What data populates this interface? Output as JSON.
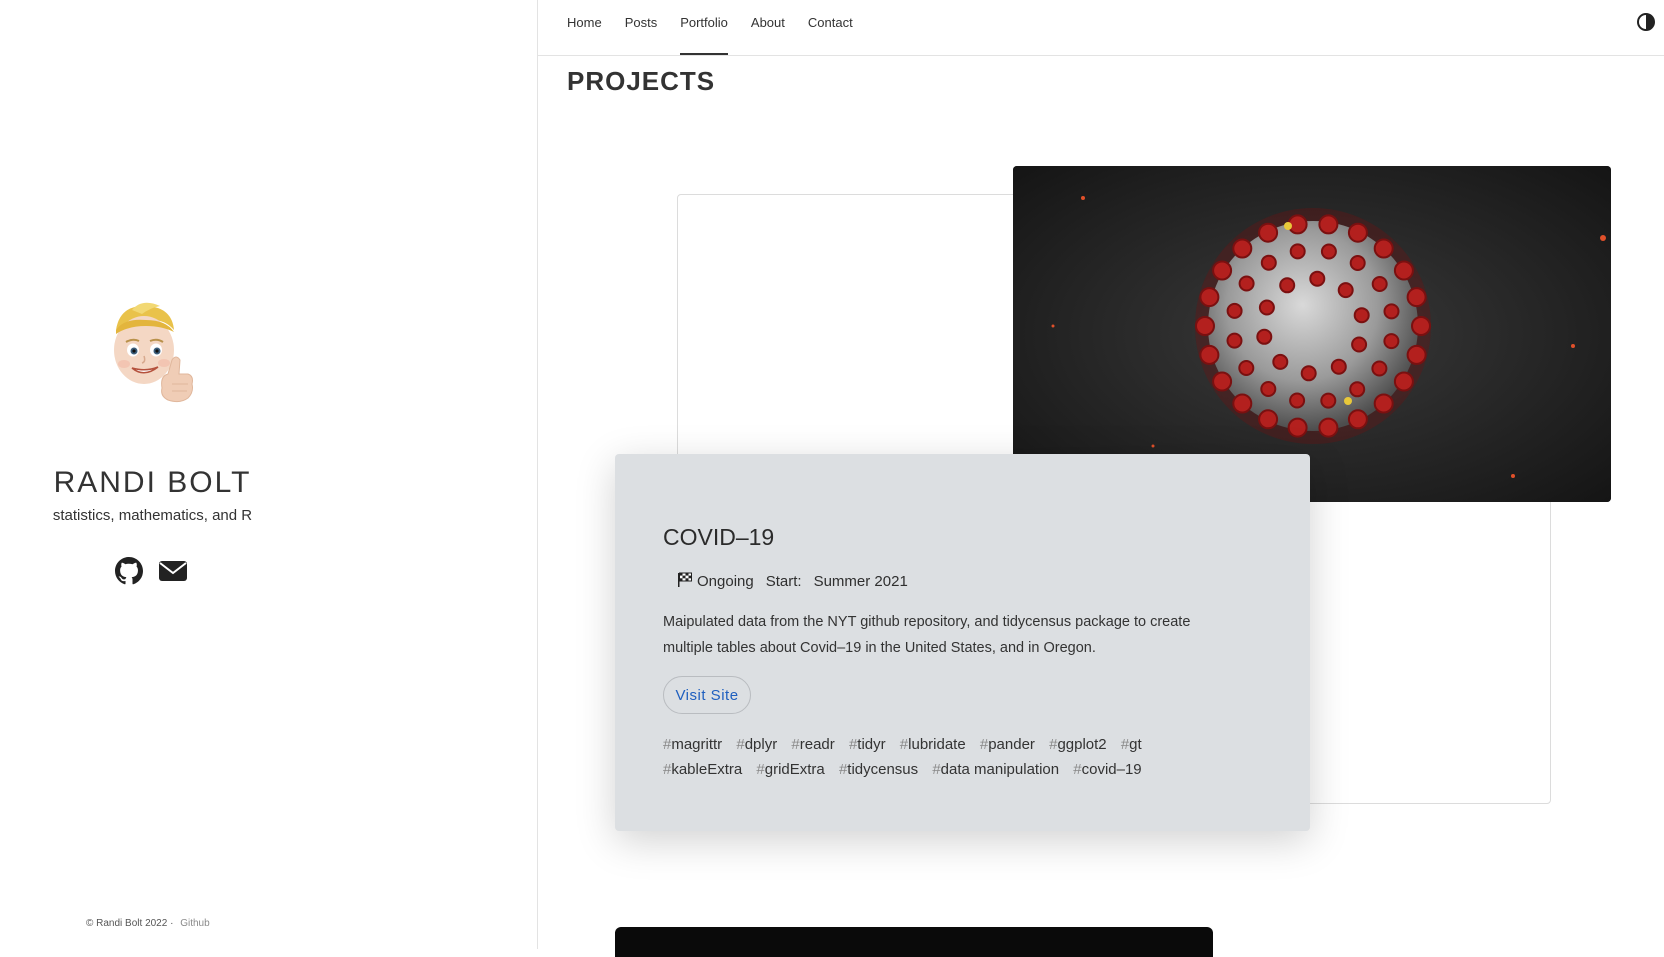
{
  "sidebar": {
    "name": "RANDI BOLT",
    "tagline": "statistics, mathematics, and R",
    "avatar_icon": "memoji-thumbs-up-icon",
    "social_icons": [
      "github-icon",
      "email-icon"
    ],
    "footer": {
      "copyright": "© Randi Bolt 2022 ·",
      "link": "Github"
    }
  },
  "nav": {
    "items": [
      {
        "label": "Home"
      },
      {
        "label": "Posts"
      },
      {
        "label": "Portfolio"
      },
      {
        "label": "About"
      },
      {
        "label": "Contact"
      }
    ],
    "active": "Portfolio",
    "theme_icon": "contrast-toggle-icon"
  },
  "main": {
    "page_title": "PROJECTS",
    "project": {
      "title": "COVID–19",
      "status_icon": "checkered-flag-icon",
      "status": "Ongoing",
      "start_label": "Start:",
      "start_value": "Summer 2021",
      "description": "Maipulated data from the NYT github repository, and tidycensus package to create multiple tables about Covid–19 in the United States, and in Oregon.",
      "button_label": "Visit Site",
      "tags": [
        "magrittr",
        "dplyr",
        "readr",
        "tidyr",
        "lubridate",
        "pander",
        "ggplot2",
        "gt",
        "kableExtra",
        "gridExtra",
        "tidycensus",
        "data manipulation",
        "covid–19"
      ]
    }
  },
  "colors": {
    "card_bg": "#dcdfe2",
    "link": "#1f5fbf",
    "virus_red": "#b3201e"
  }
}
